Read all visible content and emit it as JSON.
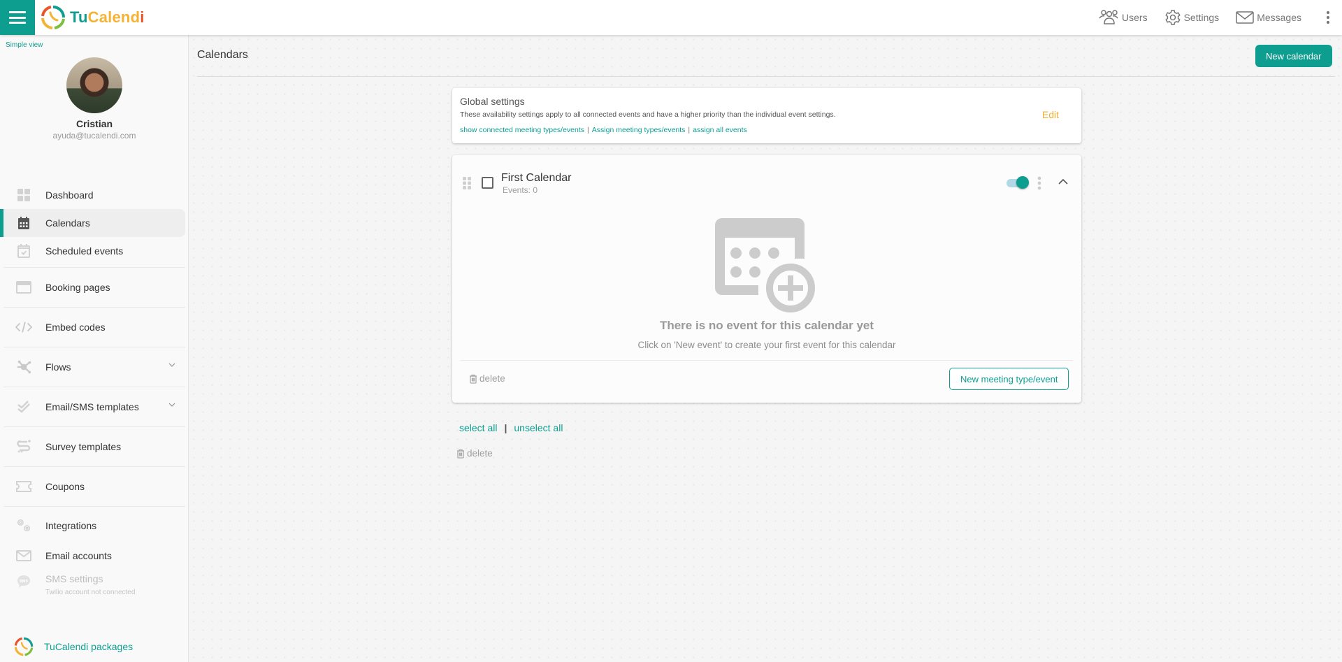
{
  "header": {
    "menu_icon": "hamburger-icon",
    "brand": {
      "part1": "Tu",
      "part2": "Calend",
      "part3": "i"
    },
    "links": [
      {
        "label": "Users",
        "icon": "users-icon"
      },
      {
        "label": "Settings",
        "icon": "gear-icon"
      },
      {
        "label": "Messages",
        "icon": "envelope-icon"
      }
    ],
    "more_icon": "more-vertical-icon"
  },
  "sidebar": {
    "simple_view_label": "Simple view",
    "profile": {
      "name": "Cristian",
      "email": "ayuda@tucalendi.com"
    },
    "items": [
      {
        "label": "Dashboard",
        "icon": "dashboard-icon",
        "active": false
      },
      {
        "label": "Calendars",
        "icon": "calendar-icon",
        "active": true
      },
      {
        "label": "Scheduled events",
        "icon": "calendar-check-icon",
        "active": false
      },
      {
        "label": "Booking pages",
        "icon": "browser-window-icon",
        "active": false
      },
      {
        "label": "Embed codes",
        "icon": "code-icon",
        "active": false
      },
      {
        "label": "Flows",
        "icon": "flows-icon",
        "expandable": true
      },
      {
        "label": "Email/SMS templates",
        "icon": "double-check-icon",
        "expandable": true
      },
      {
        "label": "Survey templates",
        "icon": "survey-icon",
        "active": false
      },
      {
        "label": "Coupons",
        "icon": "ticket-icon",
        "active": false
      },
      {
        "label": "Integrations",
        "icon": "gears-icon",
        "active": false
      },
      {
        "label": "Email accounts",
        "icon": "envelope-icon",
        "active": false
      },
      {
        "label": "SMS settings",
        "sublabel": "Twilio account not connected",
        "icon": "sms-bubble-icon",
        "disabled": true
      }
    ],
    "packages_label": "TuCalendi packages"
  },
  "main": {
    "title": "Calendars",
    "new_calendar_label": "New calendar",
    "global_settings": {
      "title": "Global settings",
      "description": "These availability settings apply to all connected events and have a higher priority than the individual event settings.",
      "links": [
        "show connected meeting types/events",
        "Assign meeting types/events",
        "assign all events"
      ],
      "separator": "|",
      "edit_label": "Edit"
    },
    "calendar": {
      "name": "First Calendar",
      "events_label": "Events: 0",
      "enabled": true,
      "empty_title": "There is no event for this calendar yet",
      "empty_subtitle": "Click on 'New event' to create your first event for this calendar",
      "delete_label": "delete",
      "new_event_label": "New meeting type/event"
    },
    "bulk": {
      "select_all": "select all",
      "separator": "|",
      "unselect_all": "unselect all",
      "delete_label": "delete"
    }
  },
  "colors": {
    "accent": "#0d9e90",
    "edit": "#f0ad2e",
    "brand_orange": "#f5b335",
    "brand_red": "#e8552b"
  }
}
